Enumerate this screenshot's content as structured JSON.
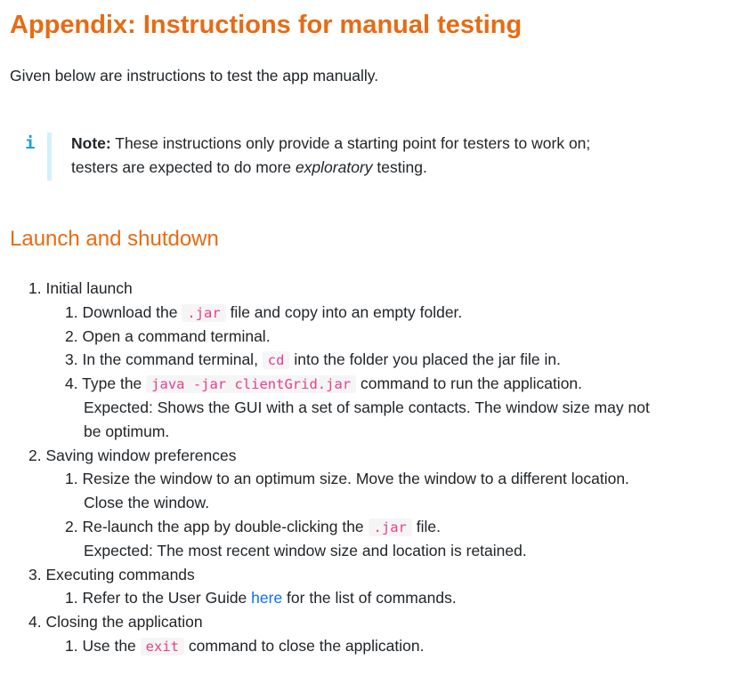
{
  "title": "Appendix: Instructions for manual testing",
  "intro": "Given below are instructions to test the app manually.",
  "note": {
    "icon": "info-icon",
    "label": "Note:",
    "text_before": " These instructions only provide a starting point for testers to work on;",
    "text_line2_before": "testers are expected to do more ",
    "text_emphasis": "exploratory",
    "text_after": " testing."
  },
  "section_title": "Launch and shutdown",
  "items": {
    "launch": {
      "num": "1.",
      "label": "Initial launch",
      "steps": {
        "s1": {
          "num": "1.",
          "before": "Download the ",
          "code": ".jar",
          "after": " file and copy into an empty folder."
        },
        "s2": {
          "num": "2.",
          "text": "Open a command terminal."
        },
        "s3": {
          "num": "3.",
          "before": "In the command terminal, ",
          "code": "cd",
          "after": " into the folder you placed the jar file in."
        },
        "s4": {
          "num": "4.",
          "before": "Type the ",
          "code": "java -jar clientGrid.jar",
          "after": " command to run the application.",
          "expected_line1": "Expected: Shows the GUI with a set of sample contacts. The window size may not",
          "expected_line2": "be optimum."
        }
      }
    },
    "saving": {
      "num": "2.",
      "label": "Saving window preferences",
      "steps": {
        "s1": {
          "num": "1.",
          "line1": "Resize the window to an optimum size. Move the window to a different location.",
          "line2": "Close the window."
        },
        "s2": {
          "num": "2.",
          "before": "Re-launch the app by double-clicking the ",
          "code": ".jar",
          "after": " file.",
          "expected": "Expected: The most recent window size and location is retained."
        }
      }
    },
    "executing": {
      "num": "3.",
      "label": "Executing commands",
      "steps": {
        "s1": {
          "num": "1.",
          "before": "Refer to the User Guide ",
          "link": "here",
          "after": " for the list of commands."
        }
      }
    },
    "closing": {
      "num": "4.",
      "label": "Closing the application",
      "steps": {
        "s1": {
          "num": "1.",
          "before": "Use the ",
          "code": "exit",
          "after": " command to close the application."
        }
      }
    }
  }
}
